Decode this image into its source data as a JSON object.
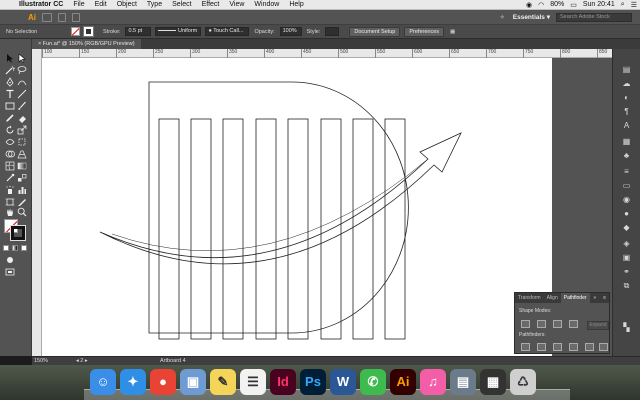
{
  "menubar": {
    "app_name": "Illustrator CC",
    "items": [
      "File",
      "Edit",
      "Object",
      "Type",
      "Select",
      "Effect",
      "View",
      "Window",
      "Help"
    ],
    "battery": "80%",
    "clock": "Sun 20:41"
  },
  "appbar": {
    "logo": "Ai",
    "workspace": "Essentials",
    "workspace_arrow": "▾",
    "search_placeholder": "Search Adobe Stock"
  },
  "controlbar": {
    "selection": "No Selection",
    "stroke_label": "Stroke:",
    "stroke_value": "0.5 pt",
    "profile": "Uniform",
    "brush": "Touch Call...",
    "opacity_label": "Opacity:",
    "opacity_value": "100%",
    "style_label": "Style:",
    "document_setup": "Document Setup",
    "preferences": "Preferences"
  },
  "document": {
    "tab_title": "Fun.ai* @ 150% (RGB/GPU Preview)",
    "close_glyph": "×"
  },
  "ruler": {
    "ticks": [
      "100",
      "150",
      "200",
      "250",
      "300",
      "350",
      "400",
      "450",
      "500",
      "550",
      "600",
      "650",
      "700",
      "750",
      "800",
      "850",
      "900"
    ]
  },
  "pathfinder_panel": {
    "tabs": [
      "Transform",
      "Align",
      "Pathfinder"
    ],
    "active_tab": "Pathfinder",
    "shape_modes_label": "Shape Modes:",
    "pathfinders_label": "Pathfinders:",
    "expand_label": "Expand",
    "collapse_glyph": "»",
    "menu_glyph": "≡"
  },
  "statusbar": {
    "zoom": "150%",
    "artboard_number": "2",
    "artboard_name": "Artboard 4"
  },
  "dock": {
    "apps": [
      {
        "name": "Finder",
        "glyph": "☺",
        "color": "#3b8ee8"
      },
      {
        "name": "Safari",
        "glyph": "✦",
        "color": "#2f8fe6"
      },
      {
        "name": "Chrome",
        "glyph": "●",
        "color": "#e94335"
      },
      {
        "name": "Preview",
        "glyph": "▣",
        "color": "#6e9bd1"
      },
      {
        "name": "Notes",
        "glyph": "✎",
        "color": "#f5d45a"
      },
      {
        "name": "Reminders",
        "glyph": "☰",
        "color": "#f2f2f2"
      },
      {
        "name": "InDesign",
        "glyph": "Id",
        "color": "#49021f"
      },
      {
        "name": "Photoshop",
        "glyph": "Ps",
        "color": "#001e36"
      },
      {
        "name": "Word",
        "glyph": "W",
        "color": "#2b5797"
      },
      {
        "name": "FaceTime",
        "glyph": "✆",
        "color": "#3dbb4e"
      },
      {
        "name": "Illustrator",
        "glyph": "Ai",
        "color": "#330000"
      },
      {
        "name": "iTunes",
        "glyph": "♫",
        "color": "#f45ea8"
      },
      {
        "name": "Image Capture",
        "glyph": "▤",
        "color": "#6b7b8c"
      },
      {
        "name": "Photo Booth",
        "glyph": "▦",
        "color": "#333333"
      },
      {
        "name": "Trash",
        "glyph": "♺",
        "color": "#cfcfcf"
      }
    ]
  }
}
